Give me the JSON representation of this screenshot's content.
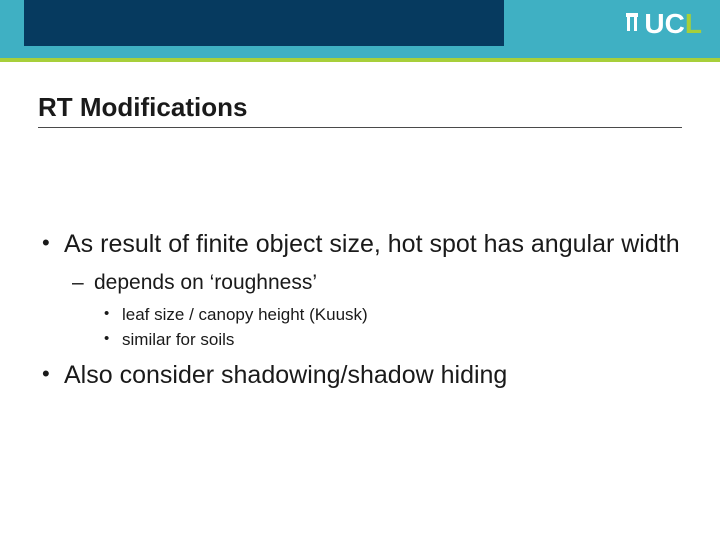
{
  "brand": {
    "logo_text": "UCL"
  },
  "slide": {
    "title": "RT Modifications",
    "bullets": [
      {
        "text": "As result of finite object size, hot spot has angular width",
        "children": [
          {
            "text": "depends on ‘roughness’",
            "children": [
              {
                "text": "leaf size / canopy height (Kuusk)"
              },
              {
                "text": "similar for soils"
              }
            ]
          }
        ]
      },
      {
        "text": "Also consider shadowing/shadow hiding"
      }
    ]
  }
}
